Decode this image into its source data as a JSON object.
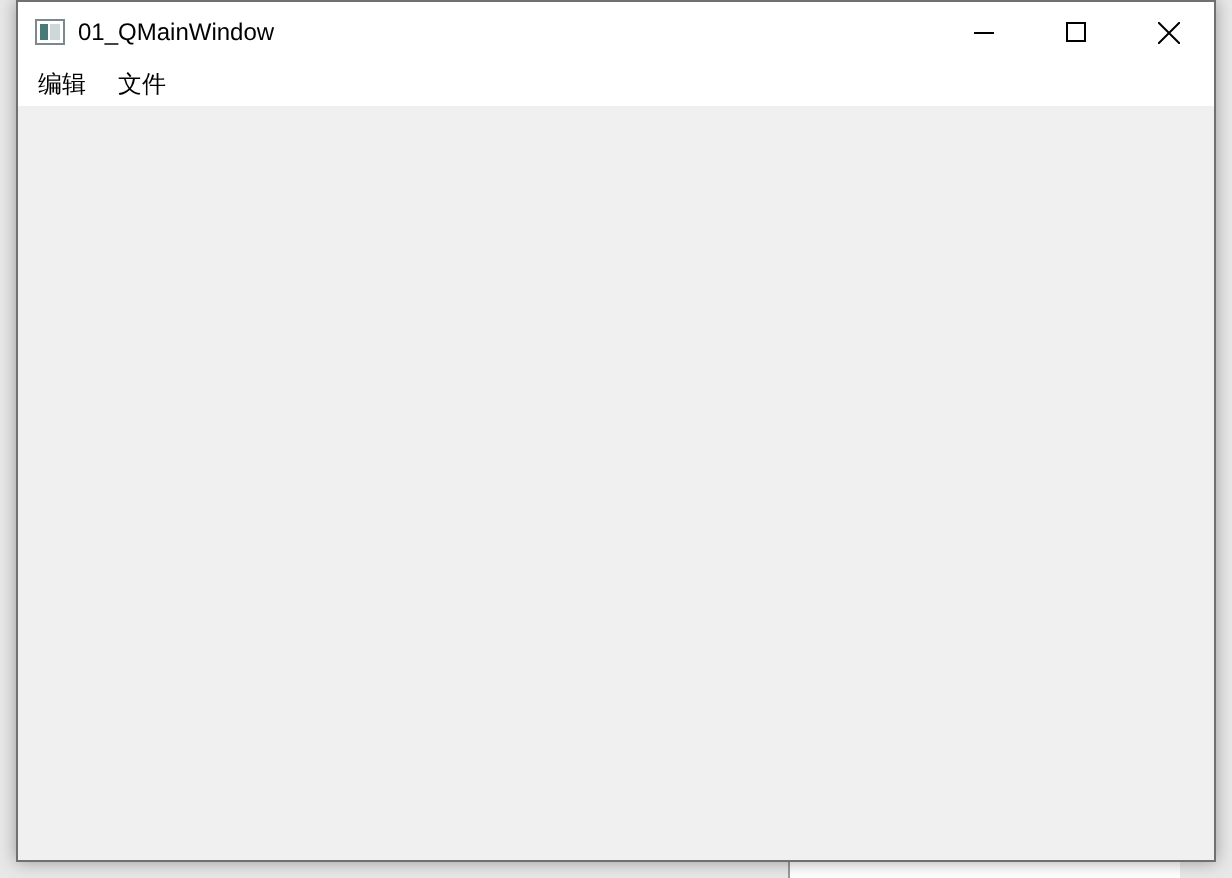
{
  "window": {
    "title": "01_QMainWindow"
  },
  "menu": [
    {
      "label": "编辑"
    },
    {
      "label": "文件"
    }
  ]
}
